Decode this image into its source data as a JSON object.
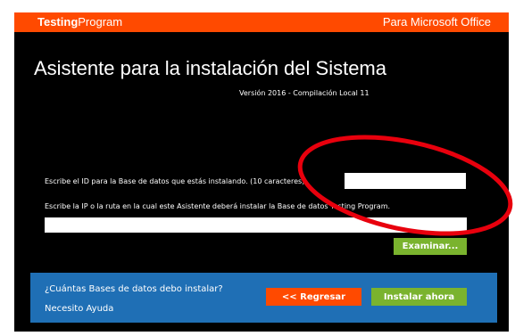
{
  "header": {
    "brand_bold": "Testing",
    "brand_light": "Program",
    "product": "Para Microsoft Office"
  },
  "wizard": {
    "title": "Asistente para la instalación del Sistema",
    "version": "Versión 2016 - Compilación Local 11"
  },
  "form": {
    "id_label": "Escribe el ID para la Base de datos que estás instalando. (10 caracteres)",
    "id_value": "",
    "path_label": "Escribe la IP o la ruta en la cual este Asistente deberá instalar la Base de datos Testing Program.",
    "path_value": "",
    "browse_label": "Examinar..."
  },
  "footer": {
    "faq_link": "¿Cuántas Bases de datos debo instalar?",
    "help_link": "Necesito Ayuda",
    "back_label": "<< Regresar",
    "install_label": "Instalar ahora"
  },
  "colors": {
    "accent_orange": "#ff4a00",
    "accent_green": "#7ab32e",
    "footer_blue": "#1f6fb5",
    "annotation_red": "#e8000d"
  }
}
